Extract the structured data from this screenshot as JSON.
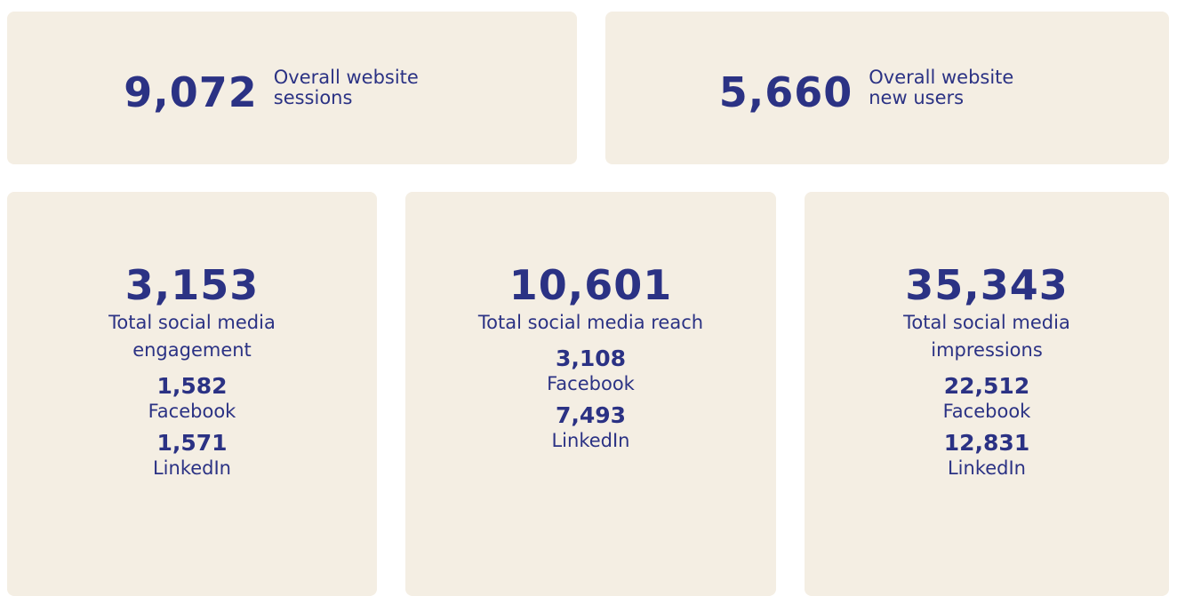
{
  "top_stats": [
    {
      "value": "9,072",
      "label": "Overall website sessions"
    },
    {
      "value": "5,660",
      "label": "Overall website new users"
    }
  ],
  "social_stats": [
    {
      "value": "3,153",
      "label": "Total social media engagement",
      "breakdown": [
        {
          "value": "1,582",
          "platform": "Facebook"
        },
        {
          "value": "1,571",
          "platform": "LinkedIn"
        }
      ]
    },
    {
      "value": "10,601",
      "label": "Total social media reach",
      "breakdown": [
        {
          "value": "3,108",
          "platform": "Facebook"
        },
        {
          "value": "7,493",
          "platform": "LinkedIn"
        }
      ]
    },
    {
      "value": "35,343",
      "label": "Total social media impressions",
      "breakdown": [
        {
          "value": "22,512",
          "platform": "Facebook"
        },
        {
          "value": "12,831",
          "platform": "LinkedIn"
        }
      ]
    }
  ],
  "colors": {
    "card_background": "#f4eee3",
    "text": "#2b3284"
  }
}
